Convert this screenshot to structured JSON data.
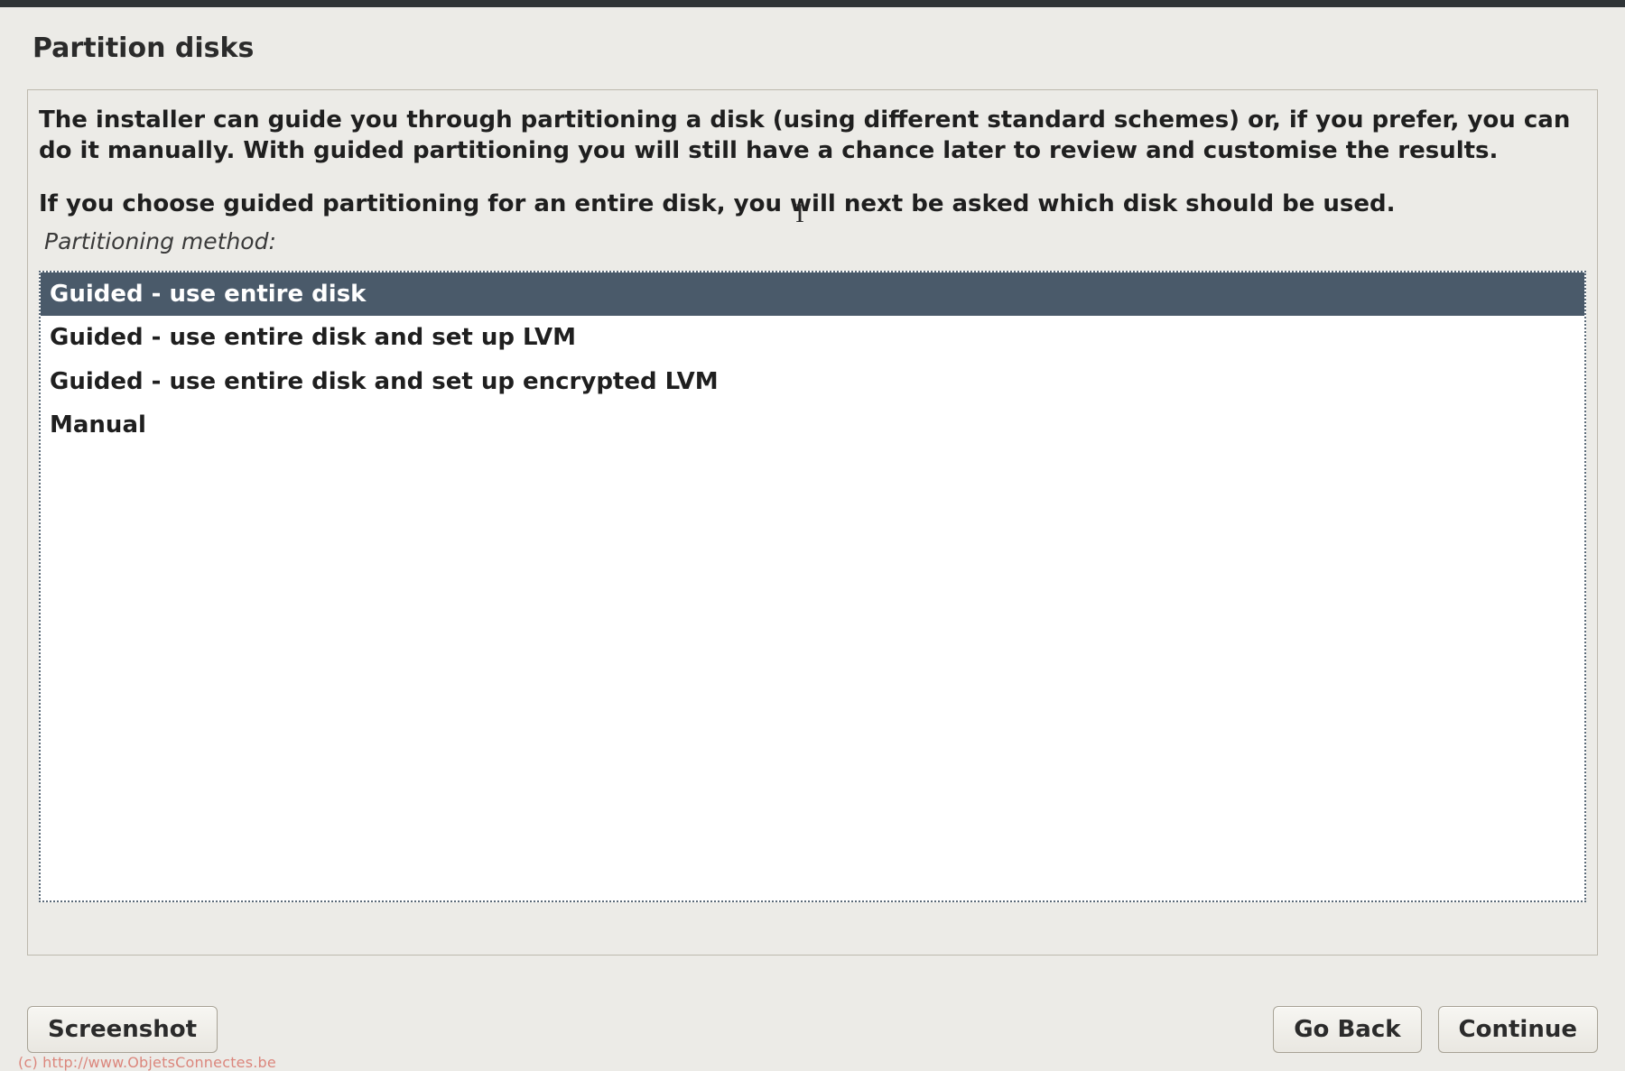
{
  "page": {
    "title": "Partition disks",
    "intro_1": "The installer can guide you through partitioning a disk (using different standard schemes) or, if you prefer, you can do it manually. With guided partitioning you will still have a chance later to review and customise the results.",
    "intro_2": "If you choose guided partitioning for an entire disk, you will next be asked which disk should be used.",
    "method_label": "Partitioning method:"
  },
  "options": [
    {
      "label": "Guided - use entire disk",
      "selected": true
    },
    {
      "label": "Guided - use entire disk and set up LVM",
      "selected": false
    },
    {
      "label": "Guided - use entire disk and set up encrypted LVM",
      "selected": false
    },
    {
      "label": "Manual",
      "selected": false
    }
  ],
  "buttons": {
    "screenshot": "Screenshot",
    "go_back": "Go Back",
    "continue": "Continue"
  },
  "watermark": "(c) http://www.ObjetsConnectes.be"
}
